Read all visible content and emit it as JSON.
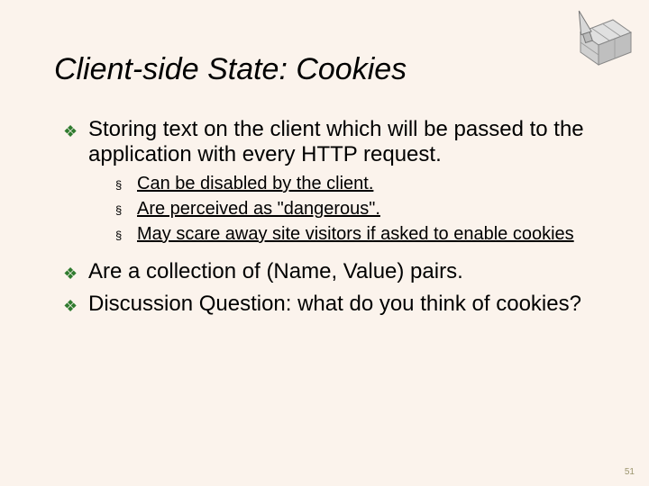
{
  "title": "Client-side State: Cookies",
  "bullets": {
    "a": {
      "text": "Storing text on the client which will be passed to the application with every HTTP request.",
      "sub": {
        "s1": "Can be disabled by the client.",
        "s2": "Are perceived as \"dangerous\".",
        "s3": "May scare away site visitors if asked to enable cookies"
      }
    },
    "b": {
      "text": "Are a collection of (Name, Value) pairs."
    },
    "c": {
      "text": "Discussion Question: what do you think of cookies?"
    }
  },
  "glyph": {
    "l1": "❖",
    "l2": "§"
  },
  "page_number": "51"
}
